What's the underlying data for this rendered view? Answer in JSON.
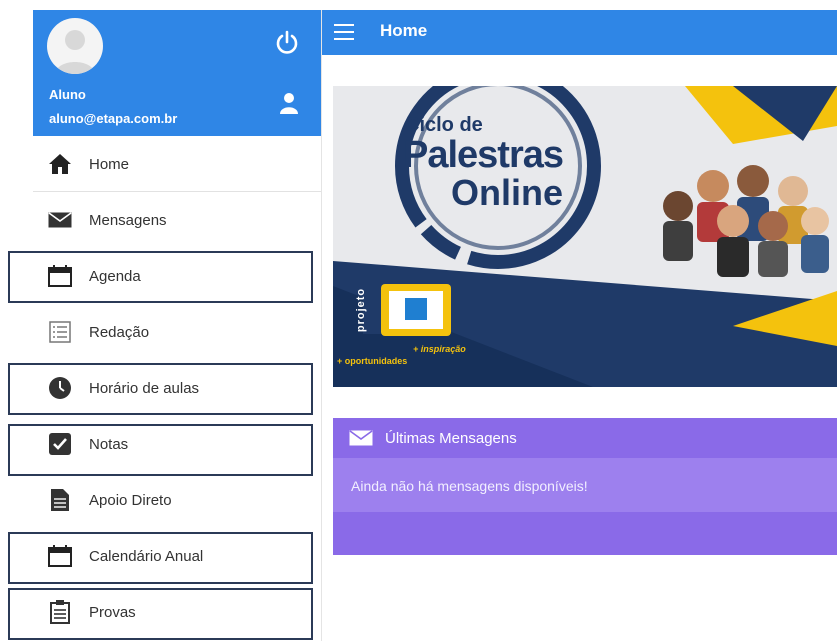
{
  "user": {
    "name": "Aluno",
    "email": "aluno@etapa.com.br"
  },
  "header": {
    "title": "Home"
  },
  "menu": [
    {
      "label": "Home",
      "icon": "home-icon"
    },
    {
      "label": "Mensagens",
      "icon": "envelope-icon"
    },
    {
      "label": "Agenda",
      "icon": "calendar-icon"
    },
    {
      "label": "Redação",
      "icon": "list-icon"
    },
    {
      "label": "Horário de aulas",
      "icon": "clock-icon"
    },
    {
      "label": "Notas",
      "icon": "checkbox-icon"
    },
    {
      "label": "Apoio Direto",
      "icon": "document-icon"
    },
    {
      "label": "Calendário Anual",
      "icon": "calendar-icon"
    },
    {
      "label": "Provas",
      "icon": "clipboard-icon"
    }
  ],
  "banner": {
    "line1": "Ciclo de",
    "line2": "Palestras",
    "line3": "Online",
    "vertical": "projeto",
    "tag1": "+ inspiração",
    "tag2": "+ oportunidades"
  },
  "messages": {
    "title": "Últimas Mensagens",
    "empty": "Ainda não há mensagens disponíveis!"
  },
  "colors": {
    "primary": "#2f86e6",
    "card": "#8a6ae8",
    "banner_navy": "#1f3a68",
    "banner_yellow": "#f4c20d"
  }
}
